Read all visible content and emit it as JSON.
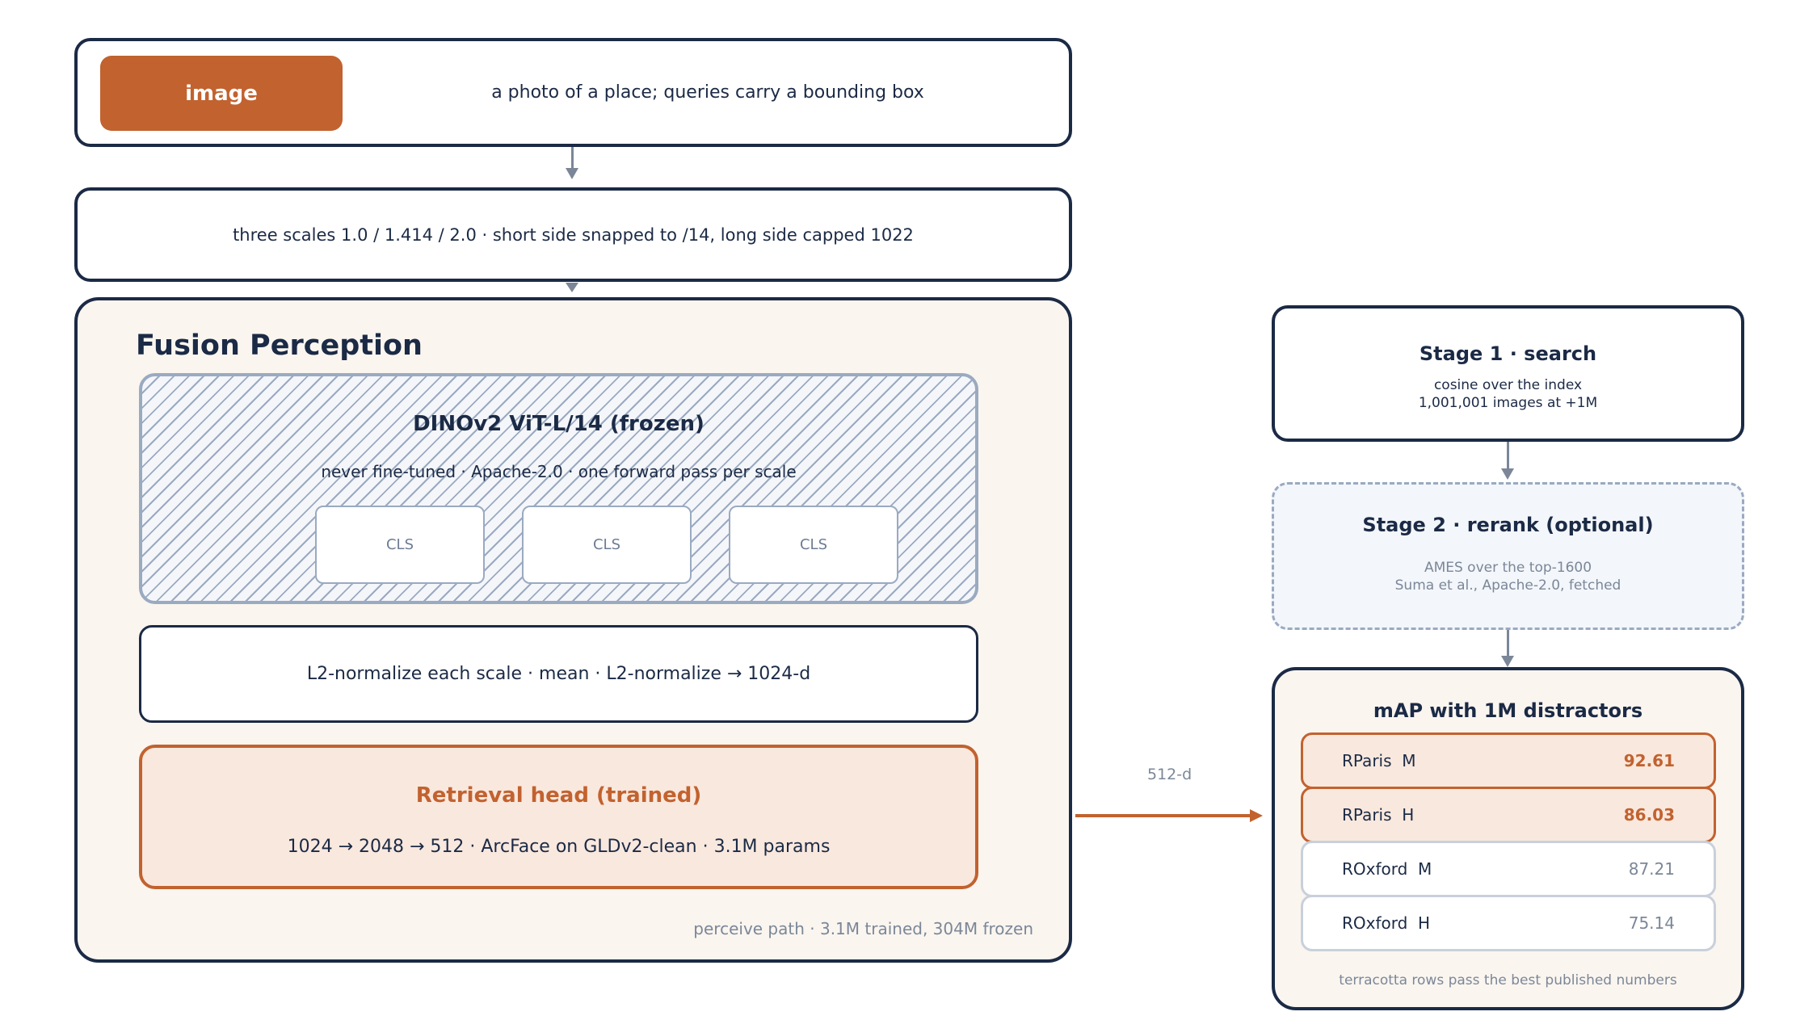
{
  "input": {
    "chip_label": "image",
    "description": "a photo of a place; queries carry a bounding box"
  },
  "scales": {
    "text": "three scales  1.0 / 1.414 / 2.0  ·  short side snapped to /14, long side capped 1022"
  },
  "fusion": {
    "title": "Fusion Perception",
    "backbone": {
      "title": "DINOv2 ViT-L/14  (frozen)",
      "subtitle": "never fine-tuned  ·  Apache-2.0  ·  one forward pass per scale",
      "tokens": [
        "CLS",
        "CLS",
        "CLS"
      ]
    },
    "normalize": "L2-normalize each scale  ·  mean  ·  L2-normalize   →   1024-d",
    "head": {
      "title": "Retrieval head  (trained)",
      "subtitle": "1024 → 2048 → 512  ·  ArcFace on GLDv2-clean  ·  3.1M params"
    },
    "footer": "perceive path  ·  3.1M trained, 304M frozen"
  },
  "output_label": "512-d",
  "stage1": {
    "title": "Stage 1  ·  search",
    "line1": "cosine over the index",
    "line2": "1,001,001 images at +1M"
  },
  "stage2": {
    "title": "Stage 2  ·  rerank  (optional)",
    "line1": "AMES over the top-1600",
    "line2": "Suma et al., Apache-2.0, fetched"
  },
  "results": {
    "title": "mAP with 1M distractors",
    "rows": [
      {
        "label": "RParis  M",
        "value": "92.61",
        "highlight": true
      },
      {
        "label": "RParis  H",
        "value": "86.03",
        "highlight": true
      },
      {
        "label": "ROxford  M",
        "value": "87.21",
        "highlight": false
      },
      {
        "label": "ROxford  H",
        "value": "75.14",
        "highlight": false
      }
    ],
    "footer": "terracotta rows pass the best published numbers"
  },
  "colors": {
    "navy": "#1b2a45",
    "terracotta": "#c2622f",
    "terracotta_fill": "#f9e8de",
    "slate": "#9aaac1",
    "grey_text": "#7b8798",
    "panel_fill": "#faf5ef"
  }
}
